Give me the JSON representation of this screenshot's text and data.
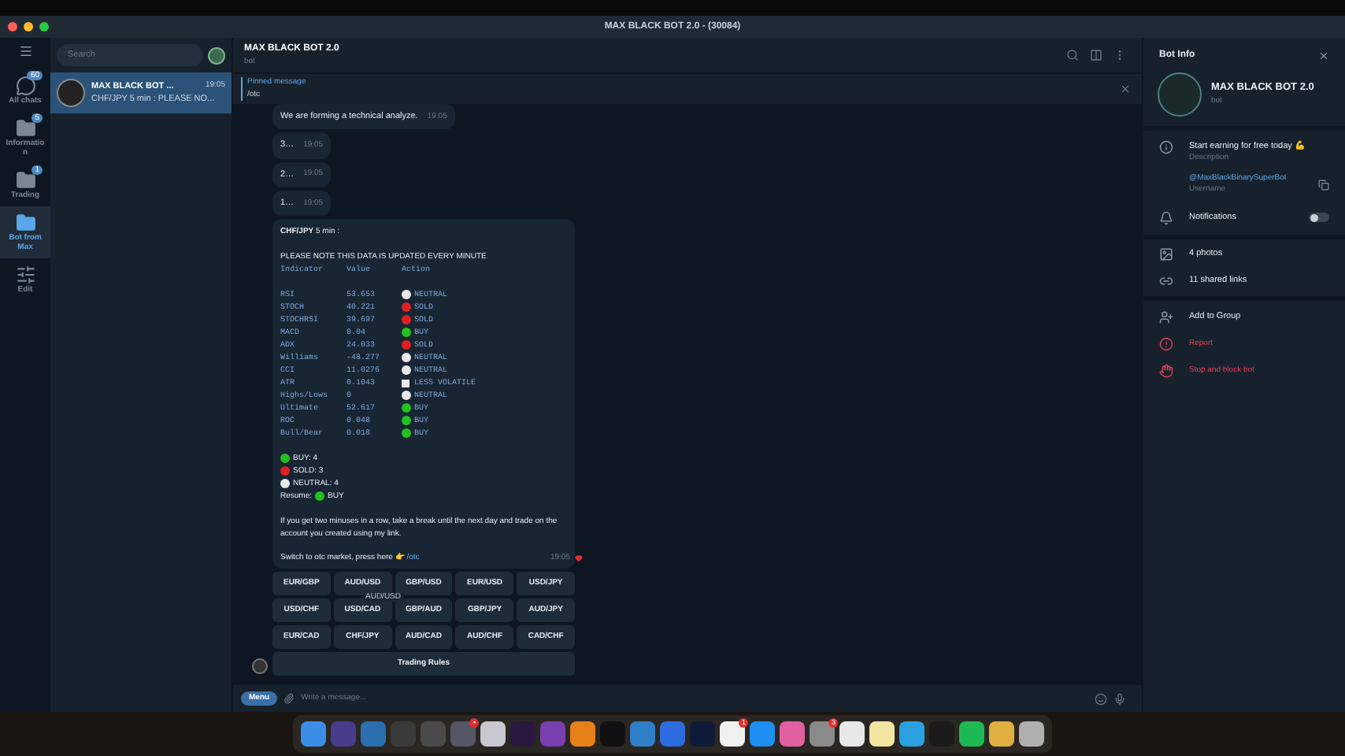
{
  "window": {
    "title": "MAX BLACK BOT 2.0 - (30084)"
  },
  "folders": [
    {
      "label": "All chats",
      "kind": "chats",
      "badge": "60",
      "selected": false
    },
    {
      "label": "Informatio n",
      "kind": "folder",
      "badge": "5",
      "selected": false
    },
    {
      "label": "Trading",
      "kind": "folder",
      "badge": "1",
      "selected": false
    },
    {
      "label": "Bot from Max",
      "kind": "folder",
      "selected": true
    },
    {
      "label": "Edit",
      "kind": "edit",
      "selected": false
    }
  ],
  "search": {
    "placeholder": "Search"
  },
  "chats": [
    {
      "name": "MAX BLACK BOT ...",
      "time": "19:05",
      "preview": "CHF/JPY 5 min :  PLEASE NO...",
      "selected": true
    }
  ],
  "chat_header": {
    "title": "MAX BLACK BOT 2.0",
    "subtitle": "bot"
  },
  "pinned": {
    "label": "Pinned message",
    "text": "/otc"
  },
  "messages": [
    {
      "text": "We are forming a technical analyze.",
      "time": "19:05"
    },
    {
      "text": "3…",
      "time": "19:05"
    },
    {
      "text": "2…",
      "time": "19:05"
    },
    {
      "text": "1…",
      "time": "19:05"
    }
  ],
  "report": {
    "title": "CHF/JPY",
    "title_rest": " 5 min :",
    "note": "PLEASE NOTE THIS DATA IS UPDATED EVERY MINUTE",
    "columns": [
      "Indicator",
      "Value",
      "Action"
    ],
    "rows": [
      {
        "name": "RSI",
        "value": "53.653",
        "kind": "neutral",
        "action": "NEUTRAL"
      },
      {
        "name": "STOCH",
        "value": "40.221",
        "kind": "sold",
        "action": "SOLD"
      },
      {
        "name": "STOCHRSI",
        "value": "39.697",
        "kind": "sold",
        "action": "SOLD"
      },
      {
        "name": "MACD",
        "value": "0.04",
        "kind": "buy",
        "action": "BUY"
      },
      {
        "name": "ADX",
        "value": "24.033",
        "kind": "sold",
        "action": "SOLD"
      },
      {
        "name": "Williams",
        "value": "-48.277",
        "kind": "neutral",
        "action": "NEUTRAL"
      },
      {
        "name": "CCI",
        "value": "11.0276",
        "kind": "neutral",
        "action": "NEUTRAL"
      },
      {
        "name": "ATR",
        "value": "0.1043",
        "kind": "square",
        "action": "LESS VOLATILE"
      },
      {
        "name": "Highs/Lows",
        "value": "0",
        "kind": "neutral",
        "action": "NEUTRAL"
      },
      {
        "name": "Ultimate",
        "value": "52.617",
        "kind": "buy",
        "action": "BUY"
      },
      {
        "name": "ROC",
        "value": "0.048",
        "kind": "buy",
        "action": "BUY"
      },
      {
        "name": "Bull/Bear",
        "value": "0.018",
        "kind": "buy",
        "action": "BUY"
      }
    ],
    "summary": [
      {
        "kind": "buy",
        "text": "BUY: 4"
      },
      {
        "kind": "sold",
        "text": "SOLD: 3"
      },
      {
        "kind": "neutral",
        "text": "NEUTRAL: 4"
      }
    ],
    "resume": {
      "label": "Resume:",
      "kind": "buy",
      "text": "BUY"
    },
    "advice": "If you get two minuses in a row, take a break until the next day and trade on the account you created using my link.",
    "switch_text": "Switch to otc market, press here 👉",
    "switch_link": "/otc",
    "time": "19:05",
    "liked": true
  },
  "keyboard": [
    [
      "EUR/GBP",
      "AUD/USD",
      "GBP/USD",
      "EUR/USD",
      "USD/JPY"
    ],
    [
      "USD/CHF",
      "USD/CAD",
      "GBP/AUD",
      "GBP/JPY",
      "AUD/JPY"
    ],
    [
      "EUR/CAD",
      "CHF/JPY",
      "AUD/CAD",
      "AUD/CHF",
      "CAD/CHF"
    ]
  ],
  "keyboard_wide": "Trading Rules",
  "tooltip": "AUD/USD",
  "composer": {
    "menu": "Menu",
    "placeholder": "Write a message..."
  },
  "bot_info": {
    "title": "Bot Info",
    "name": "MAX BLACK BOT 2.0",
    "subtitle": "bot",
    "description": "Start earning for free today 💪",
    "description_label": "Description",
    "username": "@MaxBlackBinarySuperBot",
    "username_label": "Username",
    "notifications": {
      "label": "Notifications",
      "on": false
    },
    "media": [
      {
        "kind": "photo",
        "label": "4 photos"
      },
      {
        "kind": "link",
        "label": "11 shared links"
      }
    ],
    "actions": [
      {
        "kind": "add",
        "label": "Add to Group",
        "danger": false
      },
      {
        "kind": "report",
        "label": "Report",
        "danger": true
      },
      {
        "kind": "hand",
        "label": "Stop and block bot",
        "danger": true
      }
    ]
  },
  "dock": [
    {
      "color": "#3b8ee8"
    },
    {
      "color": "#4a3c8c"
    },
    {
      "color": "#2a6fb0"
    },
    {
      "color": "#3a3a3a"
    },
    {
      "color": "#4a4a4a"
    },
    {
      "color": "#555566",
      "badge": "•"
    },
    {
      "color": "#c8c8d0"
    },
    {
      "color": "#2a1840"
    },
    {
      "color": "#7a3fb0"
    },
    {
      "color": "#e8801a"
    },
    {
      "color": "#111111"
    },
    {
      "color": "#2f7ec8"
    },
    {
      "color": "#2d6be0"
    },
    {
      "color": "#0e1a3a"
    },
    {
      "color": "#f0f0f0",
      "badge": "1"
    },
    {
      "color": "#1d8ff0"
    },
    {
      "color": "#e060a0"
    },
    {
      "color": "#8a8a8a",
      "badge": "3"
    },
    {
      "color": "#e8e8e8"
    },
    {
      "color": "#f4e6a0"
    },
    {
      "color": "#2aa0e0"
    },
    {
      "color": "#1a1a1a"
    },
    {
      "color": "#1db954"
    },
    {
      "color": "#e0b040"
    },
    {
      "color": "#b0b0b0"
    }
  ]
}
